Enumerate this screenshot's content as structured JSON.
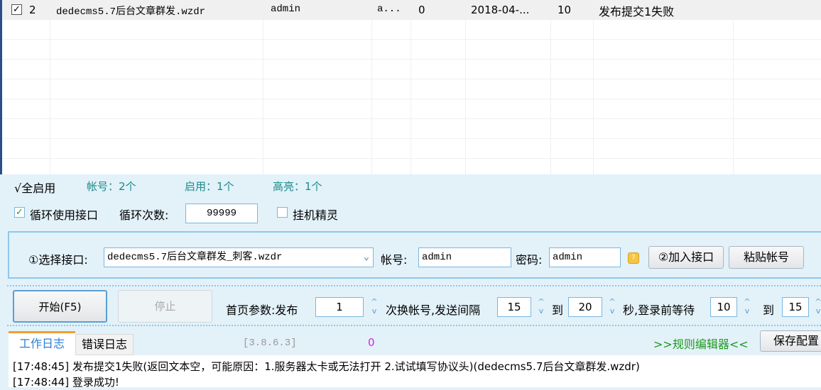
{
  "table": {
    "rows": [
      {
        "checked": true,
        "index": "2",
        "interface": "dedecms5.7后台文章群发.wzdr",
        "account": "admin",
        "col4": "a...",
        "col5": "0",
        "date": "2018-04-...",
        "col7": "10",
        "status": "发布提交1失败"
      }
    ]
  },
  "stats": {
    "enable_all": "√全启用",
    "accounts": "帐号：2个",
    "enabled": "启用：1个",
    "highlight": "高亮：1个"
  },
  "options": {
    "loop_label": "循环使用接口",
    "loop_checked": true,
    "loop_count_label": "循环次数:",
    "loop_count": "99999",
    "hangup_label": "挂机精灵",
    "hangup_checked": false
  },
  "interface_box": {
    "select_label": "①选择接口:",
    "selected": "dedecms5.7后台文章群发_刺客.wzdr",
    "account_label": "帐号:",
    "account": "admin",
    "password_label": "密码:",
    "password": "admin",
    "add_btn": "②加入接口",
    "paste_btn": "粘贴帐号"
  },
  "controls": {
    "start": "开始(F5)",
    "stop": "停止",
    "params_label": "首页参数:发布",
    "publish_count": "1",
    "switch_label": "次换帐号,发送间隔",
    "interval_from": "15",
    "to1": "到",
    "interval_to": "20",
    "wait_label": "秒,登录前等待",
    "wait_from": "10",
    "to2": "到",
    "wait_to": "15"
  },
  "log": {
    "tabs": [
      "工作日志",
      "错误日志"
    ],
    "version": "[3.8.6.3]",
    "counter": "0",
    "rule_editor": ">>规则编辑器<<",
    "save_config": "保存配置",
    "lines": [
      "[17:48:45] 发布提交1失败(返回文本空，可能原因：1.服务器太卡或无法打开 2.试试填写协议头)(dedecms5.7后台文章群发.wzdr)",
      "[17:48:44] 登录成功!"
    ]
  }
}
